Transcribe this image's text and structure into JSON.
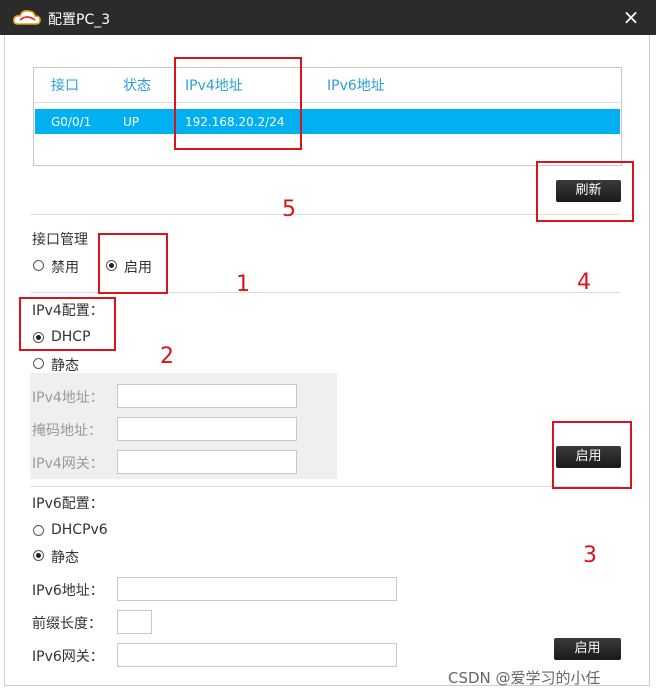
{
  "window": {
    "title": "配置PC_3",
    "close_icon": "×"
  },
  "interface_table": {
    "headers": [
      "接口",
      "状态",
      "IPv4地址",
      "IPv6地址"
    ],
    "rows": [
      {
        "interface": "G0/0/1",
        "status": "UP",
        "ipv4": "192.168.20.2/24",
        "ipv6": ""
      }
    ]
  },
  "refresh_button": "刷新",
  "interface_mgmt": {
    "title": "接口管理",
    "disable": "禁用",
    "enable": "启用",
    "selected": "启用"
  },
  "ipv4": {
    "title": "IPv4配置：",
    "dhcp": "DHCP",
    "static": "静态",
    "selected": "DHCP",
    "address_label": "IPv4地址：",
    "mask_label": "掩码地址：",
    "gateway_label": "IPv4网关：",
    "address": "",
    "mask": "",
    "gateway": "",
    "apply_button": "启用"
  },
  "ipv6": {
    "title": "IPv6配置：",
    "dhcp": "DHCPv6",
    "static": "静态",
    "selected": "静态",
    "address_label": "IPv6地址：",
    "prefix_label": "前缀长度：",
    "gateway_label": "IPv6网关：",
    "address": "",
    "prefix": "",
    "gateway": "",
    "apply_button": "启用"
  },
  "annotations": [
    "1",
    "2",
    "3",
    "4",
    "5"
  ],
  "watermark": "CSDN @爱学习的小任",
  "colors": {
    "titlebar": "#2b2b2b",
    "selected_row": "#00b0f0",
    "header_text": "#2aa0d8",
    "annotation": "#d8141c"
  }
}
